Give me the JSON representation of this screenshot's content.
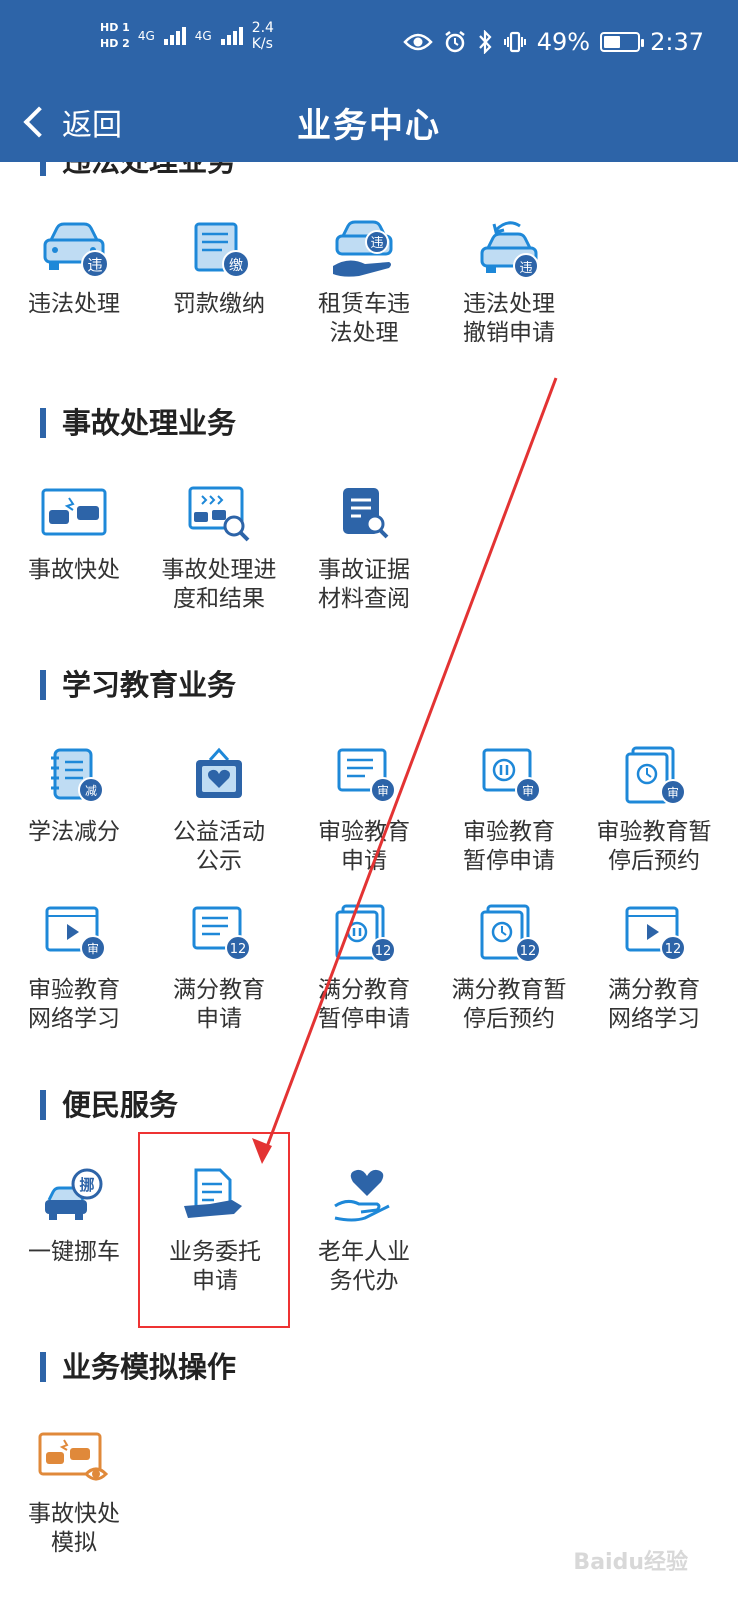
{
  "status_bar": {
    "hd1": "HD 1",
    "hd2": "HD 2",
    "sig1": "4G",
    "sig2": "4G",
    "speed_value": "2.4",
    "speed_unit": "K/s",
    "battery": "49%",
    "battery_level": 0.49,
    "time": "2:37"
  },
  "nav": {
    "back_label": "返回",
    "title": "业务中心"
  },
  "sections": {
    "weifa": "违法处理业务",
    "shigu": "事故处理业务",
    "xuexi": "学习教育业务",
    "bianmin": "便民服务",
    "moni": "业务模拟操作"
  },
  "tiles": {
    "t1": "违法处理",
    "t2": "罚款缴纳",
    "t3": "租赁车违\n法处理",
    "t4": "违法处理\n撤销申请",
    "t5": "事故快处",
    "t6": "事故处理进\n度和结果",
    "t7": "事故证据\n材料查阅",
    "t8": "学法减分",
    "t9": "公益活动\n公示",
    "t10": "审验教育\n申请",
    "t11": "审验教育\n暂停申请",
    "t12": "审验教育暂\n停后预约",
    "t13": "审验教育\n网络学习",
    "t14": "满分教育\n申请",
    "t15": "满分教育\n暂停申请",
    "t16": "满分教育暂\n停后预约",
    "t17": "满分教育\n网络学习",
    "t18": "一键挪车",
    "t19": "业务委托\n申请",
    "t20": "老年人业\n务代办",
    "t21": "事故快处\n模拟"
  },
  "badges": {
    "wei": "违",
    "jiao": "缴",
    "jian": "减",
    "shen": "审",
    "twelve": "12",
    "nuo": "挪"
  },
  "colors": {
    "primary": "#2d64a8",
    "accent": "#1e88d8",
    "orange": "#e0893a",
    "annotation": "#e33333"
  },
  "watermark": "Baidu经验"
}
